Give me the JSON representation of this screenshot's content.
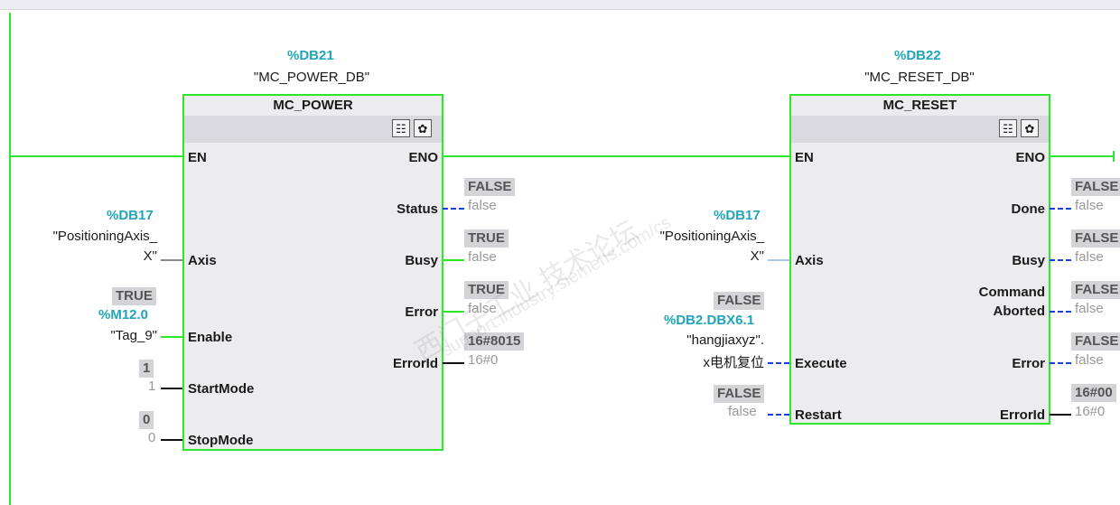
{
  "watermark": {
    "line1": "西门子工业 技术论坛",
    "line2": "support.industry.siemens.com/cs"
  },
  "power": {
    "db": "%DB21",
    "db_name": "\"MC_POWER_DB\"",
    "title": "MC_POWER",
    "pins": {
      "en": "EN",
      "eno": "ENO",
      "axis": "Axis",
      "enable": "Enable",
      "startmode": "StartMode",
      "stopmode": "StopMode",
      "status": "Status",
      "busy": "Busy",
      "error": "Error",
      "errorid": "ErrorId"
    },
    "axis_db": "%DB17",
    "axis_name1": "\"PositioningAxis_",
    "axis_name2": "X\"",
    "enable_mon": "TRUE",
    "enable_addr": "%M12.0",
    "enable_tag": "\"Tag_9\"",
    "startmode_mon": "1",
    "startmode_val": "1",
    "stopmode_mon": "0",
    "stopmode_val": "0",
    "status_mon": "FALSE",
    "status_val": "false",
    "busy_mon": "TRUE",
    "busy_val": "false",
    "error_mon": "TRUE",
    "error_val": "false",
    "errorid_mon": "16#8015",
    "errorid_val": "16#0"
  },
  "reset": {
    "db": "%DB22",
    "db_name": "\"MC_RESET_DB\"",
    "title": "MC_RESET",
    "pins": {
      "en": "EN",
      "eno": "ENO",
      "axis": "Axis",
      "execute": "Execute",
      "restart": "Restart",
      "done": "Done",
      "busy": "Busy",
      "cmd1": "Command",
      "cmd2": "Aborted",
      "error": "Error",
      "errorid": "ErrorId"
    },
    "axis_db": "%DB17",
    "axis_name1": "\"PositioningAxis_",
    "axis_name2": "X\"",
    "execute_mon": "FALSE",
    "execute_addr": "%DB2.DBX6.1",
    "execute_tag1": "\"hangjiaxyz\".",
    "execute_tag2": "x电机复位",
    "restart_mon": "FALSE",
    "restart_val": "false",
    "done_mon": "FALSE",
    "done_val": "false",
    "busy_mon": "FALSE",
    "busy_val": "false",
    "cmd_mon": "FALSE",
    "cmd_val": "false",
    "error_mon": "FALSE",
    "error_val": "false",
    "errorid_mon": "16#00",
    "errorid_val": "16#0"
  }
}
